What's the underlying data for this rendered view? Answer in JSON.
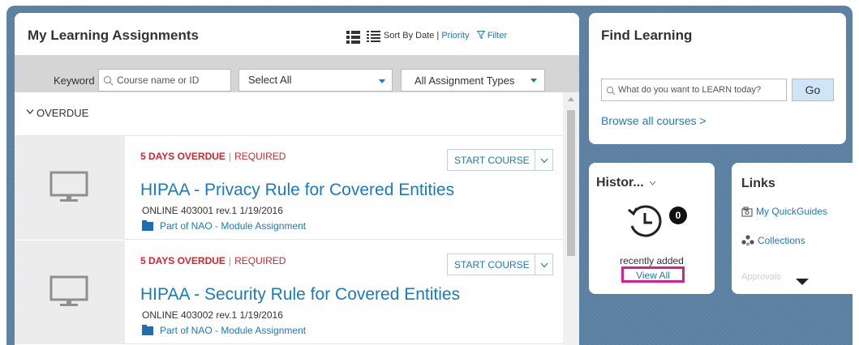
{
  "assignments": {
    "title": "My Learning Assignments",
    "sort_label": "Sort By Date",
    "sort_sep": "|",
    "priority_label": "Priority",
    "filter_label": "Filter",
    "keyword_label": "Keyword",
    "keyword_placeholder": "Course name or ID",
    "select_all": "Select All",
    "assignment_types": "All Assignment Types",
    "section_label": "OVERDUE",
    "courses": [
      {
        "overdue": "5 DAYS OVERDUE",
        "sep": "|",
        "required": "REQUIRED",
        "action": "START COURSE",
        "title": "HIPAA - Privacy Rule for Covered Entities",
        "meta": "ONLINE 403001 rev.1 1/19/2016",
        "part": "Part of NAO - Module Assignment"
      },
      {
        "overdue": "5 DAYS OVERDUE",
        "sep": "|",
        "required": "REQUIRED",
        "action": "START COURSE",
        "title": "HIPAA - Security Rule for Covered Entities",
        "meta": "ONLINE 403002 rev.1 1/19/2016",
        "part": "Part of NAO - Module Assignment"
      }
    ]
  },
  "find": {
    "title": "Find Learning",
    "search_placeholder": "What do you want to LEARN today?",
    "go": "Go",
    "browse": "Browse all courses >"
  },
  "history": {
    "title": "Histor...",
    "count": "0",
    "recent": "recently added",
    "view_all": "View All"
  },
  "links": {
    "title": "Links",
    "quickguides": "My QuickGuides",
    "collections": "Collections",
    "faded": "Approvals"
  },
  "colors": {
    "accent": "#1a7abf",
    "overdue": "#d0262d",
    "highlight": "#d91e8d",
    "background": "#5a7fa0"
  }
}
